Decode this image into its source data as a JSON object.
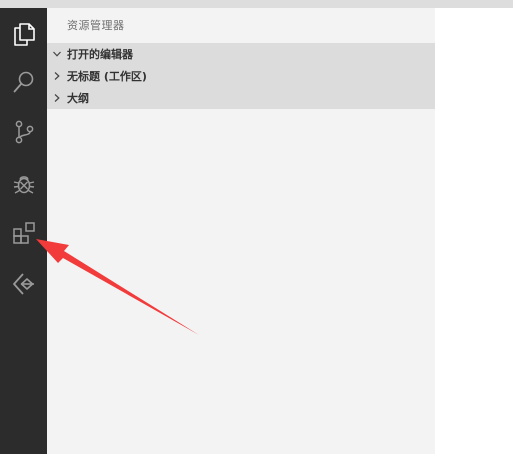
{
  "explorer": {
    "title": "资源管理器",
    "sections": [
      {
        "label": "打开的编辑器",
        "expanded": true
      },
      {
        "label": "无标题 (工作区)",
        "expanded": false
      },
      {
        "label": "大纲",
        "expanded": false
      }
    ]
  },
  "activity_bar": {
    "items": [
      "files-icon",
      "search-icon",
      "source-control-icon",
      "debug-icon",
      "extensions-icon",
      "remote-icon"
    ]
  },
  "colors": {
    "activity_bar": "#2c2c2c",
    "sidebar": "#f3f3f3",
    "section_header": "#dcdcdc",
    "annotation_arrow": "#f23b3b"
  }
}
